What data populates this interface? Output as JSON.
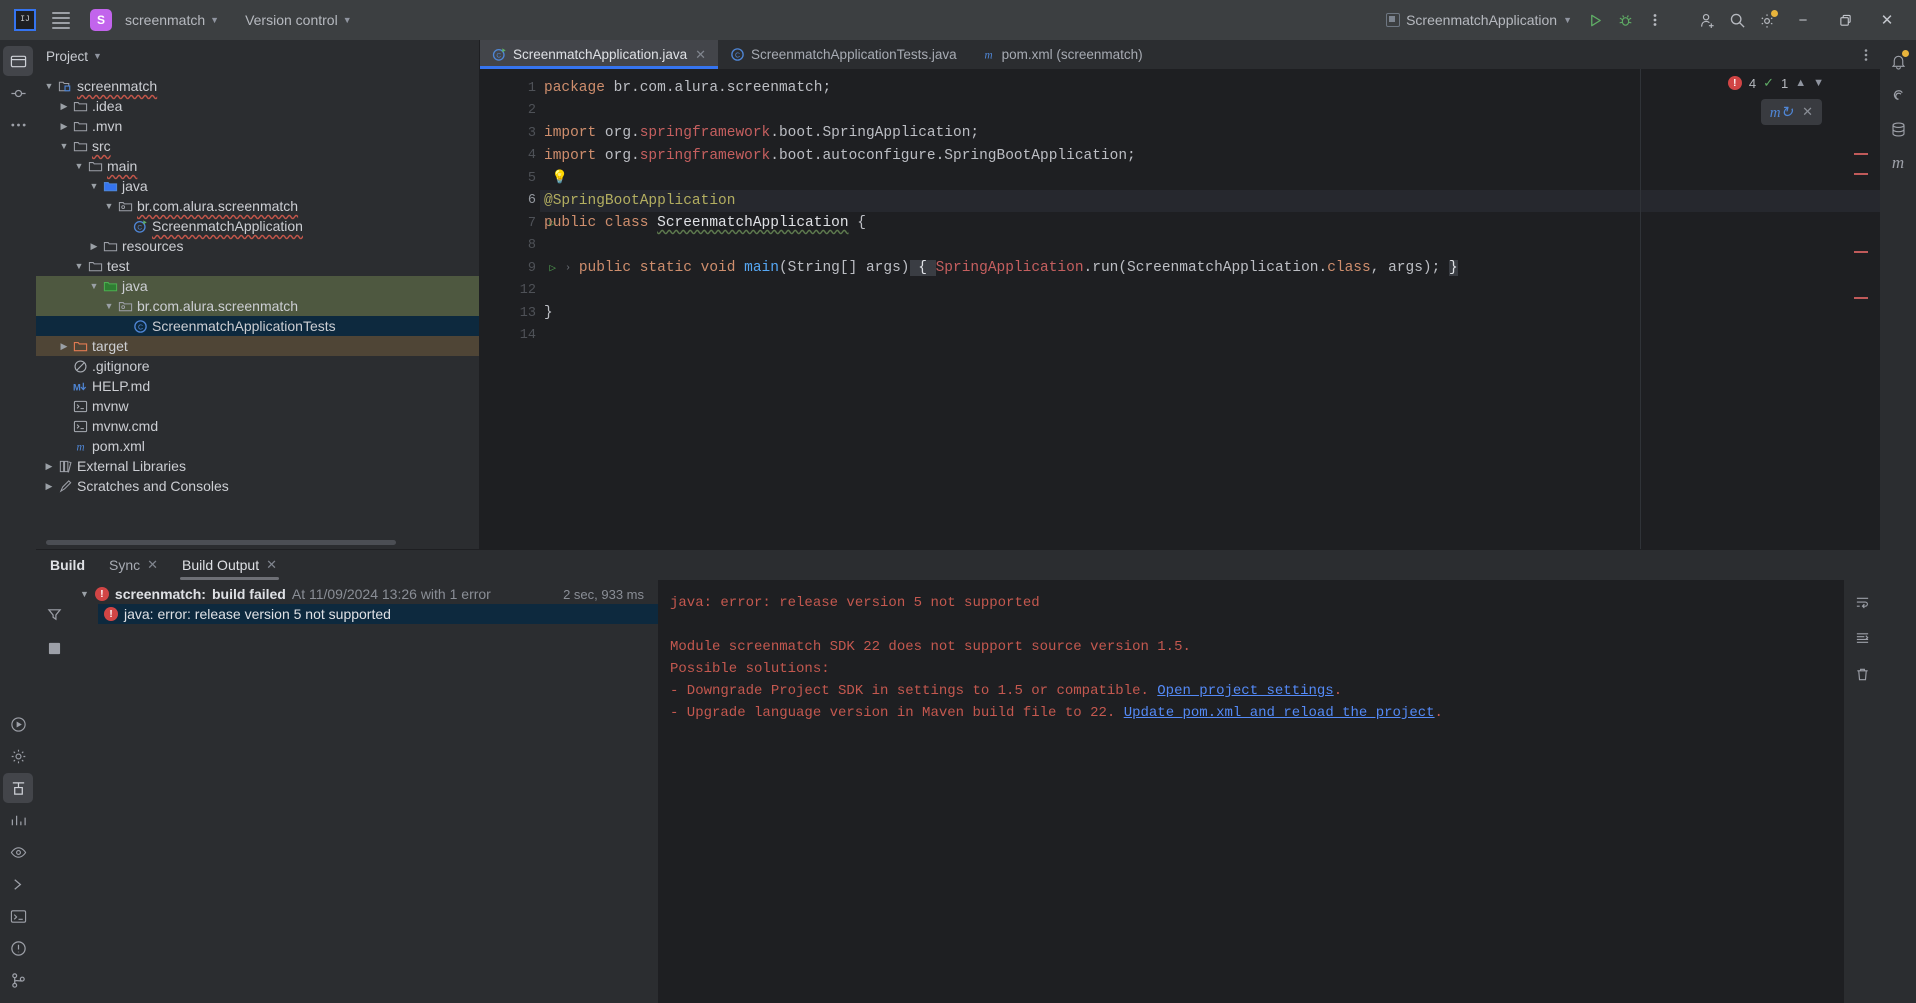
{
  "titlebar": {
    "logo": "IJ",
    "menu_icon": "hamburger-icon",
    "project_initial": "S",
    "project_name": "screenmatch",
    "version_control": "Version control",
    "run_config": "ScreenmatchApplication",
    "run_icon": "run-icon",
    "debug_icon": "debug-icon",
    "more_icon": "more-vertical-icon",
    "account_icon": "add-user-icon",
    "search_icon": "search-icon",
    "settings_icon": "gear-icon",
    "minimize": "−",
    "maximize": "❐",
    "close": "✕"
  },
  "project_panel": {
    "header": "Project",
    "tree": [
      {
        "label": "screenmatch",
        "indent": 0,
        "arrow": "down",
        "icon": "module-icon",
        "error": true
      },
      {
        "label": ".idea",
        "indent": 1,
        "arrow": "right",
        "icon": "folder-icon",
        "error": false
      },
      {
        "label": ".mvn",
        "indent": 1,
        "arrow": "right",
        "icon": "folder-icon",
        "error": false
      },
      {
        "label": "src",
        "indent": 1,
        "arrow": "down",
        "icon": "folder-icon",
        "error": true
      },
      {
        "label": "main",
        "indent": 2,
        "arrow": "down",
        "icon": "folder-icon",
        "error": true
      },
      {
        "label": "java",
        "indent": 3,
        "arrow": "down",
        "icon": "folder-source-icon",
        "error": false
      },
      {
        "label": "br.com.alura.screenmatch",
        "indent": 4,
        "arrow": "down",
        "icon": "package-icon",
        "error": true
      },
      {
        "label": "ScreenmatchApplication",
        "indent": 5,
        "arrow": "none",
        "icon": "class-run-icon",
        "error": true
      },
      {
        "label": "resources",
        "indent": 3,
        "arrow": "right",
        "icon": "folder-icon",
        "error": false
      },
      {
        "label": "test",
        "indent": 2,
        "arrow": "down",
        "icon": "folder-icon",
        "error": false
      },
      {
        "label": "java",
        "indent": 3,
        "arrow": "down",
        "icon": "folder-test-icon",
        "error": false,
        "row": "green"
      },
      {
        "label": "br.com.alura.screenmatch",
        "indent": 4,
        "arrow": "down",
        "icon": "package-icon",
        "error": false,
        "row": "green"
      },
      {
        "label": "ScreenmatchApplicationTests",
        "indent": 5,
        "arrow": "none",
        "icon": "class-icon",
        "error": false,
        "row": "sel"
      },
      {
        "label": "target",
        "indent": 1,
        "arrow": "right",
        "icon": "folder-excluded-icon",
        "error": false,
        "row": "brown"
      },
      {
        "label": ".gitignore",
        "indent": 1,
        "arrow": "none",
        "icon": "gitignore-icon",
        "error": false
      },
      {
        "label": "HELP.md",
        "indent": 1,
        "arrow": "none",
        "icon": "markdown-icon",
        "error": false
      },
      {
        "label": "mvnw",
        "indent": 1,
        "arrow": "none",
        "icon": "shell-icon",
        "error": false
      },
      {
        "label": "mvnw.cmd",
        "indent": 1,
        "arrow": "none",
        "icon": "cmd-icon",
        "error": false
      },
      {
        "label": "pom.xml",
        "indent": 1,
        "arrow": "none",
        "icon": "maven-icon",
        "error": false
      },
      {
        "label": "External Libraries",
        "indent": 0,
        "arrow": "right",
        "icon": "library-icon",
        "error": false
      },
      {
        "label": "Scratches and Consoles",
        "indent": 0,
        "arrow": "right",
        "icon": "scratch-icon",
        "error": false
      }
    ]
  },
  "editor": {
    "tabs": [
      {
        "label": "ScreenmatchApplication.java",
        "icon": "class-run-icon",
        "active": true,
        "closable": true
      },
      {
        "label": "ScreenmatchApplicationTests.java",
        "icon": "class-icon",
        "active": false,
        "closable": false
      },
      {
        "label": "pom.xml (screenmatch)",
        "icon": "maven-icon",
        "active": false,
        "closable": false
      }
    ],
    "more_icon": "more-vertical-icon",
    "line_numbers": [
      "1",
      "2",
      "3",
      "4",
      "5",
      "6",
      "7",
      "8",
      "9",
      "12",
      "13",
      "14"
    ],
    "status": {
      "error_count": "4",
      "ok_count": "1",
      "up_icon": "chevron-up-icon",
      "down_icon": "chevron-down-icon"
    },
    "widget": {
      "icon": "maven-reload-icon",
      "close": "✕"
    }
  },
  "build_panel": {
    "title": "Build",
    "tabs": [
      {
        "label": "Sync",
        "active": false,
        "closable": true
      },
      {
        "label": "Build Output",
        "active": true,
        "closable": true
      }
    ],
    "tree": [
      {
        "name": "screenmatch:",
        "status": "build failed",
        "detail": "At 11/09/2024 13:26 with 1 error",
        "time": "2 sec, 933 ms"
      },
      {
        "name": "java: error: release version 5 not supported",
        "selected": true
      }
    ],
    "output": {
      "line1": "java: error: release version 5 not supported",
      "line2": "",
      "line3": "Module screenmatch SDK 22 does not support source version 1.5.",
      "line4": "Possible solutions:",
      "line5_pre": "- Downgrade Project SDK in settings to 1.5 or compatible. ",
      "line5_link": "Open project settings",
      "line5_post": ".",
      "line6_pre": "- Upgrade language version in Maven build file to 22. ",
      "line6_link": "Update pom.xml and reload the project",
      "line6_post": "."
    },
    "side_icons": [
      "filter-icon",
      "settings-icon",
      "collapse-icon"
    ],
    "right_icons": [
      "wrap-text-icon",
      "scroll-end-icon",
      "trash-icon"
    ]
  },
  "code": {
    "l1_kw": "package",
    "l1_rest": " br.com.alura.screenmatch;",
    "l3_kw": "import",
    "l3_a": " org.",
    "l3_b": "springframework",
    "l3_c": ".boot.SpringApplication;",
    "l4_kw": "import",
    "l4_a": " org.",
    "l4_b": "springframework",
    "l4_c": ".boot.autoconfigure.SpringBootApplication;",
    "l5_bulb": "\u0001",
    "l6": "@SpringBootApplication",
    "l7_kw": "public class",
    "l7_name": "ScreenmatchApplication",
    "l7_brace": " {",
    "l9_kw": "public static void",
    "l9_m": " main",
    "l9_args": "(String[] args)",
    "l9_brace": " { ",
    "l9_call_a": "SpringApplication",
    "l9_call_b": ".run(ScreenmatchApplication.",
    "l9_cls": "class",
    "l9_tail": ", args); ",
    "l9_endbrace": "}",
    "l13": "}"
  },
  "rails": {
    "left_top": [
      "project-icon",
      "commit-icon",
      "more-tools-icon"
    ],
    "left_bottom": [
      "run-tool-icon",
      "settings-tool-icon",
      "build-tool-icon",
      "profiler-icon",
      "preview-icon",
      "run-anything-icon",
      "terminal-icon",
      "problems-icon",
      "git-icon"
    ],
    "right": [
      "notifications-icon",
      "ai-icon",
      "database-icon",
      "maven-icon"
    ]
  }
}
